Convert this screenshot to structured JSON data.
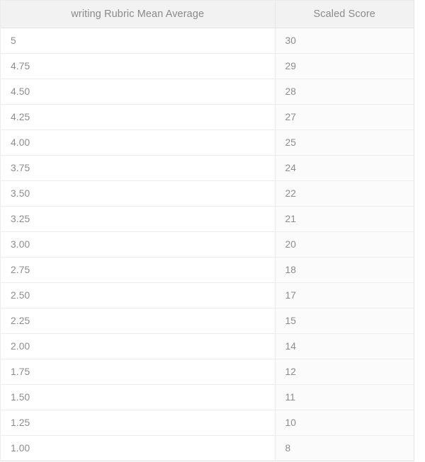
{
  "table": {
    "columns": [
      {
        "key": "rubric",
        "label": "writing Rubric Mean Average"
      },
      {
        "key": "scaled",
        "label": "Scaled Score"
      }
    ],
    "rows": [
      {
        "rubric": "5",
        "scaled": "30"
      },
      {
        "rubric": "4.75",
        "scaled": "29"
      },
      {
        "rubric": "4.50",
        "scaled": "28"
      },
      {
        "rubric": "4.25",
        "scaled": "27"
      },
      {
        "rubric": "4.00",
        "scaled": "25"
      },
      {
        "rubric": "3.75",
        "scaled": "24"
      },
      {
        "rubric": "3.50",
        "scaled": "22"
      },
      {
        "rubric": "3.25",
        "scaled": "21"
      },
      {
        "rubric": "3.00",
        "scaled": "20"
      },
      {
        "rubric": "2.75",
        "scaled": "18"
      },
      {
        "rubric": "2.50",
        "scaled": "17"
      },
      {
        "rubric": "2.25",
        "scaled": "15"
      },
      {
        "rubric": "2.00",
        "scaled": "14"
      },
      {
        "rubric": "1.75",
        "scaled": "12"
      },
      {
        "rubric": "1.50",
        "scaled": "11"
      },
      {
        "rubric": "1.25",
        "scaled": "10"
      },
      {
        "rubric": "1.00",
        "scaled": "8"
      }
    ]
  },
  "colors": {
    "header_background": "#f2f2f2",
    "header_text": "#8a8a8c",
    "cell_text": "#8c8c8e",
    "first_column_background": "#ffffff",
    "second_column_background": "#fbfbfb",
    "border": "#ededee"
  }
}
